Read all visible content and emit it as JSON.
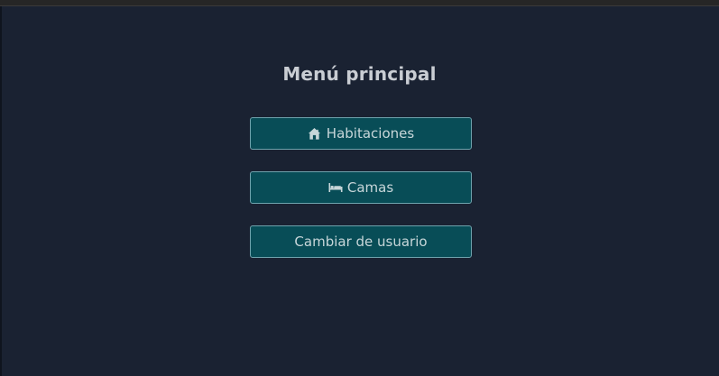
{
  "menu": {
    "title": "Menú principal",
    "buttons": [
      {
        "label": "Habitaciones",
        "icon": "house-icon"
      },
      {
        "label": "Camas",
        "icon": "bed-icon"
      },
      {
        "label": "Cambiar de usuario"
      }
    ]
  },
  "colors": {
    "background": "#1a2232",
    "button_fill": "#084d57",
    "button_border": "#6fa3ad",
    "text": "#c9cdd3"
  }
}
